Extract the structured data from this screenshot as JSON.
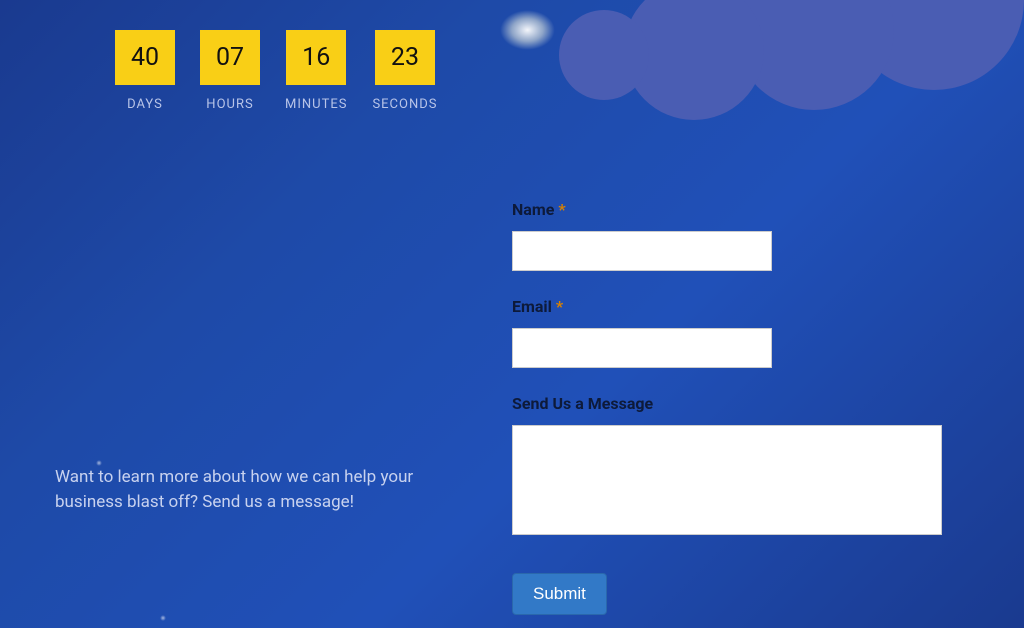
{
  "countdown": {
    "days": {
      "value": "40",
      "label": "DAYS"
    },
    "hours": {
      "value": "07",
      "label": "HOURS"
    },
    "minutes": {
      "value": "16",
      "label": "MINUTES"
    },
    "seconds": {
      "value": "23",
      "label": "SECONDS"
    }
  },
  "intro": "Want to learn more about how we can help your business blast off? Send us a message!",
  "form": {
    "name_label": "Name",
    "email_label": "Email",
    "message_label": "Send Us a Message",
    "required_mark": "*",
    "submit_label": "Submit"
  }
}
